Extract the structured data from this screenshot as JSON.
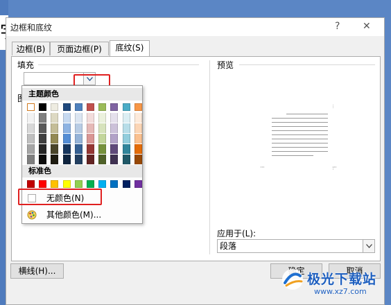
{
  "background": {
    "doc_glyph": "宇"
  },
  "dialog": {
    "title": "边框和底纹",
    "help_label": "?",
    "close_label": "✕"
  },
  "tabs": [
    {
      "label": "边框(B)",
      "active": false
    },
    {
      "label": "页面边框(P)",
      "active": false
    },
    {
      "label": "底纹(S)",
      "active": true
    }
  ],
  "fill": {
    "section_label": "填充",
    "current_value": "",
    "pattern_label_partial": "图"
  },
  "color_popup": {
    "theme_header": "主题颜色",
    "standard_header": "标准色",
    "no_color_label": "无颜色(N)",
    "more_colors_label": "其他颜色(M)..."
  },
  "theme_colors": [
    [
      "#ffffff",
      "#000000",
      "#eeece1",
      "#1f497d",
      "#4f81bd",
      "#c0504d",
      "#9bbb59",
      "#8064a2",
      "#4bacc6",
      "#f79646"
    ],
    [
      "#f2f2f2",
      "#7f7f7f",
      "#ddd9c3",
      "#c6d9f0",
      "#dbe5f1",
      "#f2dcdb",
      "#ebf1dd",
      "#e5e0ec",
      "#dbeef3",
      "#fdeada"
    ],
    [
      "#d8d8d8",
      "#595959",
      "#c4bd97",
      "#8db3e2",
      "#b8cce4",
      "#e5b9b7",
      "#d7e3bc",
      "#ccc1d9",
      "#b7dde8",
      "#fbd5b5"
    ],
    [
      "#bfbfbf",
      "#3f3f3f",
      "#938953",
      "#548dd4",
      "#95b3d7",
      "#d99694",
      "#c3d69b",
      "#b2a2c7",
      "#92cddc",
      "#fac08f"
    ],
    [
      "#a5a5a5",
      "#262626",
      "#494429",
      "#17365d",
      "#366092",
      "#953734",
      "#76923c",
      "#5f497a",
      "#31859b",
      "#e36c09"
    ],
    [
      "#7f7f7f",
      "#0c0c0c",
      "#1d1b10",
      "#0f243e",
      "#244061",
      "#632423",
      "#4f6128",
      "#3f3151",
      "#205867",
      "#974806"
    ]
  ],
  "standard_colors": [
    "#c00000",
    "#ff0000",
    "#ffc000",
    "#ffff00",
    "#92d050",
    "#00b050",
    "#00b0f0",
    "#0070c0",
    "#002060",
    "#7030a0"
  ],
  "preview": {
    "section_label": "预览",
    "apply_to_label": "应用于(L):",
    "apply_to_value": "段落"
  },
  "footer": {
    "horizontal_line_label": "横线(H)...",
    "ok_label": "确定",
    "cancel_label": "取消"
  },
  "watermark": {
    "text": "极光下载站",
    "url": "www.xz7.com"
  },
  "colors": {
    "highlight_red": "#e02020",
    "desktop_blue": "#5b86c5"
  }
}
